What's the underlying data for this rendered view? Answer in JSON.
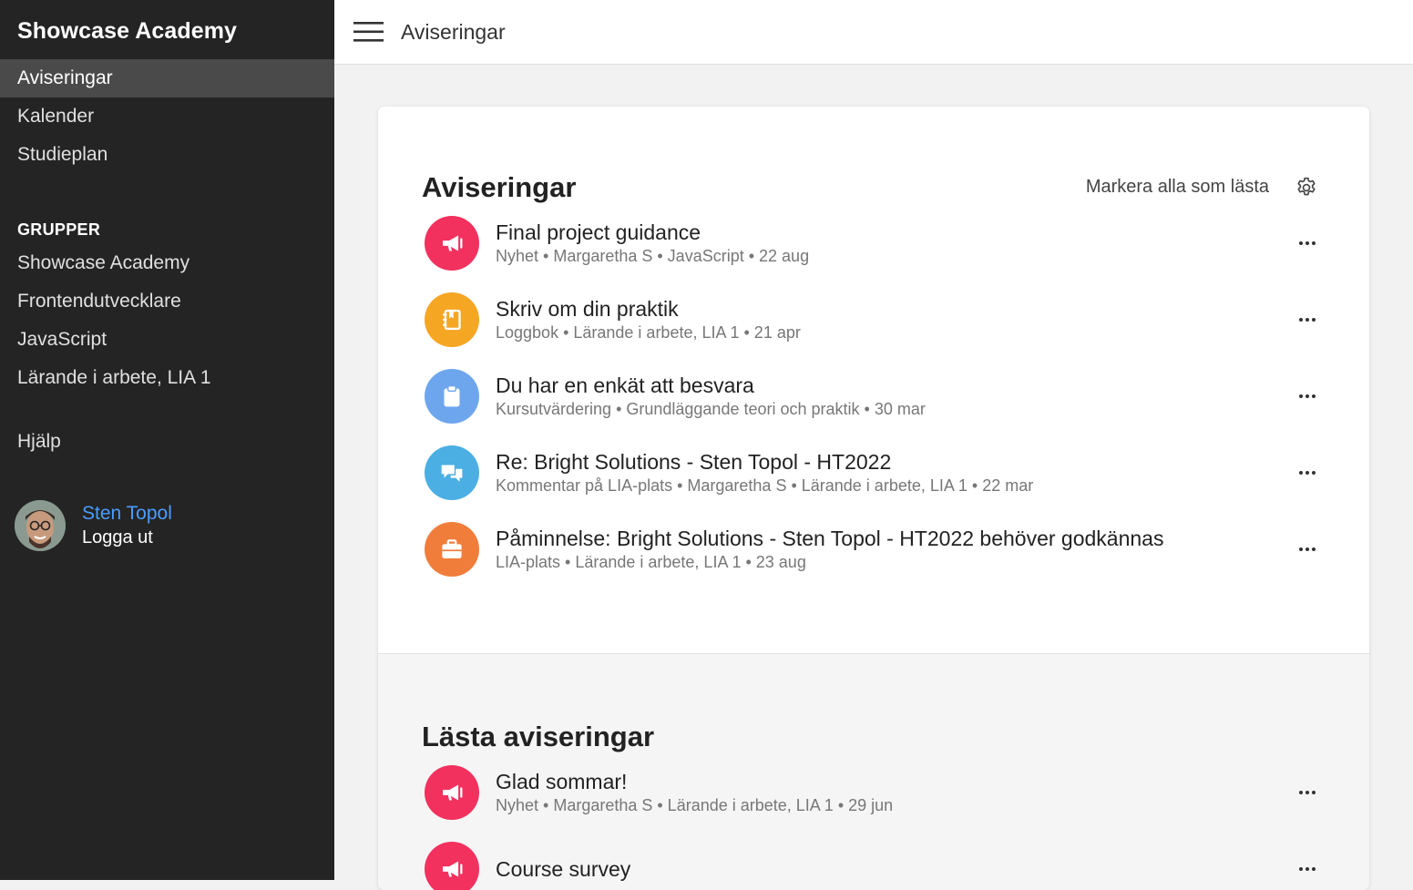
{
  "sidebar": {
    "brand": "Showcase Academy",
    "nav": [
      {
        "label": "Aviseringar",
        "active": true
      },
      {
        "label": "Kalender",
        "active": false
      },
      {
        "label": "Studieplan",
        "active": false
      }
    ],
    "groups_heading": "GRUPPER",
    "groups": [
      {
        "label": "Showcase Academy"
      },
      {
        "label": "Frontendutvecklare"
      },
      {
        "label": "JavaScript"
      },
      {
        "label": "Lärande i arbete, LIA 1"
      }
    ],
    "help": "Hjälp",
    "user": {
      "name": "Sten Topol",
      "logout": "Logga ut"
    }
  },
  "topbar": {
    "title": "Aviseringar",
    "menu_icon": "hamburger-icon"
  },
  "unread": {
    "title": "Aviseringar",
    "mark_all": "Markera alla som lästa",
    "settings_icon": "gear-icon",
    "items": [
      {
        "title": "Final project guidance",
        "meta": "Nyhet • Margaretha S • JavaScript • 22 aug",
        "icon": "megaphone-icon",
        "color": "#f2315e"
      },
      {
        "title": "Skriv om din praktik",
        "meta": "Loggbok • Lärande i arbete, LIA 1 • 21 apr",
        "icon": "logbook-icon",
        "color": "#f5a623"
      },
      {
        "title": "Du har en enkät att besvara",
        "meta": "Kursutvärdering • Grundläggande teori och praktik • 30 mar",
        "icon": "clipboard-icon",
        "color": "#6ea6ee"
      },
      {
        "title": "Re: Bright Solutions - Sten Topol - HT2022",
        "meta": "Kommentar på LIA-plats • Margaretha S • Lärande i arbete, LIA 1 • 22 mar",
        "icon": "chat-bubbles-icon",
        "color": "#4bafe3"
      },
      {
        "title": "Påminnelse: Bright Solutions - Sten Topol - HT2022 behöver godkännas",
        "meta": "LIA-plats • Lärande i arbete, LIA 1 • 23 aug",
        "icon": "briefcase-icon",
        "color": "#f17d3b"
      }
    ]
  },
  "read": {
    "title": "Lästa aviseringar",
    "items": [
      {
        "title": "Glad sommar!",
        "meta": "Nyhet • Margaretha S • Lärande i arbete, LIA 1 • 29 jun",
        "icon": "megaphone-icon",
        "color": "#f2315e"
      },
      {
        "title": "Course survey",
        "meta": "",
        "icon": "megaphone-icon",
        "color": "#f2315e"
      }
    ]
  }
}
